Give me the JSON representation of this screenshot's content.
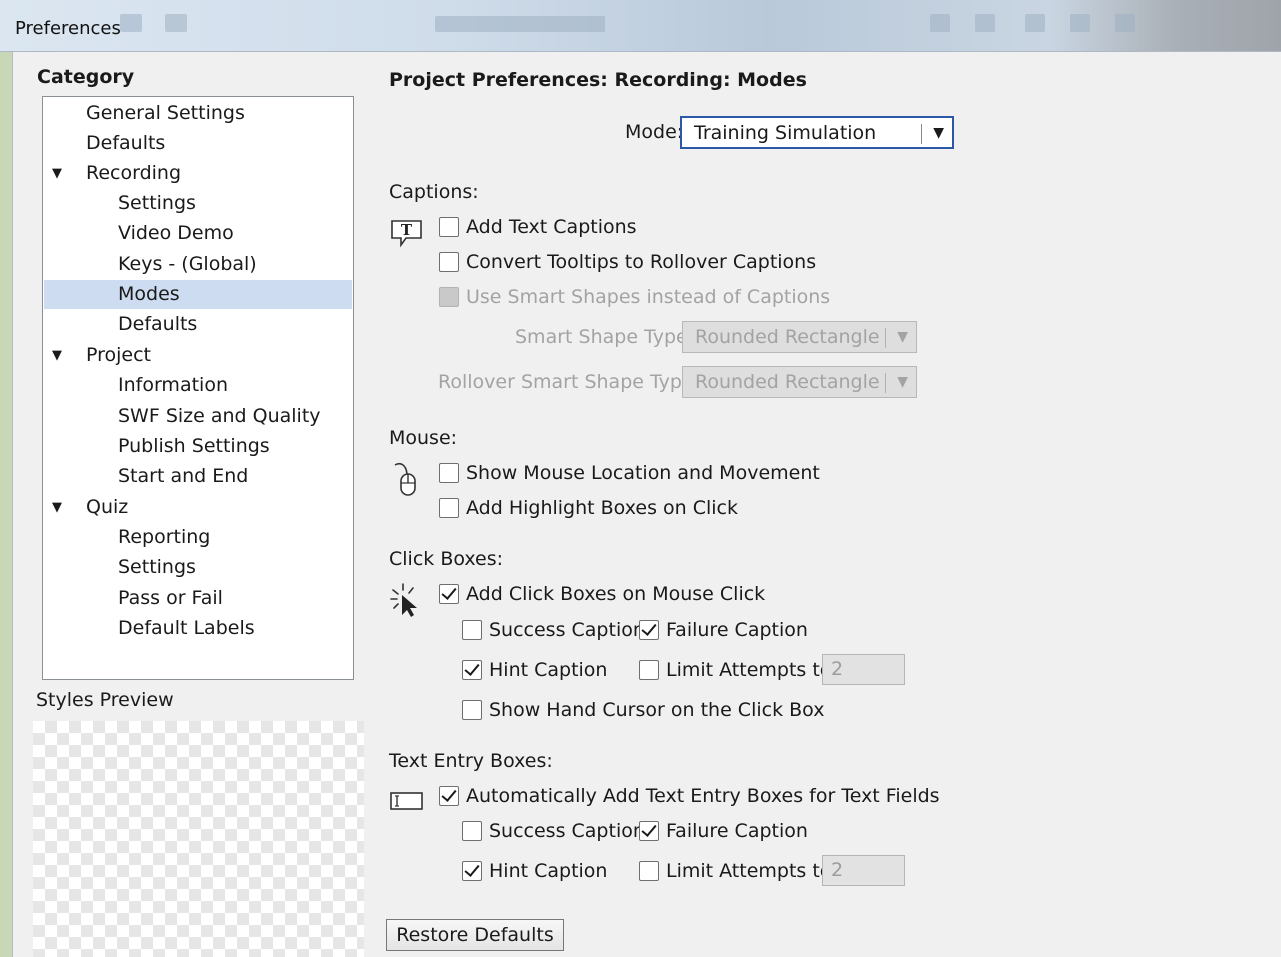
{
  "window": {
    "title": "Preferences"
  },
  "left": {
    "category_header": "Category",
    "styles_preview_label": "Styles Preview",
    "tree": [
      {
        "label": "General Settings",
        "level": 0,
        "expanded": false
      },
      {
        "label": "Defaults",
        "level": 0,
        "expanded": false
      },
      {
        "label": "Recording",
        "level": 0,
        "expanded": true
      },
      {
        "label": "Settings",
        "level": 1
      },
      {
        "label": "Video Demo",
        "level": 1
      },
      {
        "label": "Keys - (Global)",
        "level": 1
      },
      {
        "label": "Modes",
        "level": 1,
        "selected": true
      },
      {
        "label": "Defaults",
        "level": 1
      },
      {
        "label": "Project",
        "level": 0,
        "expanded": true
      },
      {
        "label": "Information",
        "level": 1
      },
      {
        "label": "SWF Size and Quality",
        "level": 1
      },
      {
        "label": "Publish Settings",
        "level": 1
      },
      {
        "label": "Start and End",
        "level": 1
      },
      {
        "label": "Quiz",
        "level": 0,
        "expanded": true
      },
      {
        "label": "Reporting",
        "level": 1
      },
      {
        "label": "Settings",
        "level": 1
      },
      {
        "label": "Pass or Fail",
        "level": 1
      },
      {
        "label": "Default Labels",
        "level": 1
      }
    ]
  },
  "right": {
    "page_title": "Project Preferences: Recording: Modes",
    "mode": {
      "label": "Mode:",
      "value": "Training Simulation"
    },
    "captions": {
      "header": "Captions:",
      "add_text_captions": "Add Text Captions",
      "convert_tooltips": "Convert Tooltips to Rollover Captions",
      "use_smart_shapes": "Use Smart Shapes instead of Captions",
      "smart_shape_type_label": "Smart Shape Type",
      "smart_shape_type_value": "Rounded Rectangle",
      "rollover_smart_shape_type_label": "Rollover Smart Shape Type",
      "rollover_smart_shape_type_value": "Rounded Rectangle"
    },
    "mouse": {
      "header": "Mouse:",
      "show_mouse_location": "Show Mouse Location and Movement",
      "add_highlight_boxes": "Add Highlight Boxes on Click"
    },
    "click_boxes": {
      "header": "Click Boxes:",
      "add_click_boxes": "Add Click Boxes on Mouse Click",
      "success_caption": "Success Caption",
      "failure_caption": "Failure Caption",
      "hint_caption": "Hint Caption",
      "limit_attempts": "Limit Attempts to",
      "limit_value": "2",
      "show_hand_cursor": "Show Hand Cursor on the Click Box"
    },
    "text_entry": {
      "header": "Text Entry Boxes:",
      "auto_add": "Automatically Add Text Entry Boxes for Text Fields",
      "success_caption": "Success Caption",
      "failure_caption": "Failure Caption",
      "hint_caption": "Hint Caption",
      "limit_attempts": "Limit Attempts to",
      "limit_value": "2"
    },
    "restore_defaults": "Restore Defaults"
  }
}
